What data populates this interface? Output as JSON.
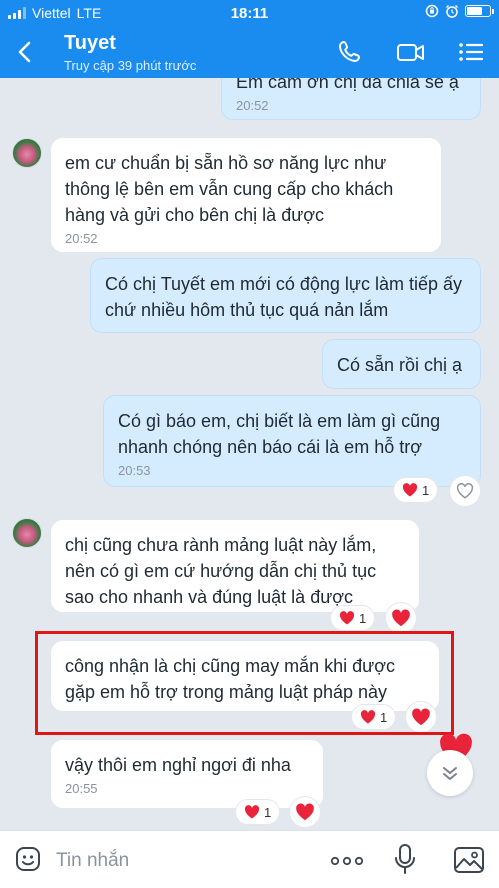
{
  "status_bar": {
    "carrier": "Viettel",
    "network": "LTE",
    "time": "18:11"
  },
  "header": {
    "contact_name": "Tuyet",
    "last_seen": "Truy cập 39 phút trước",
    "icons": [
      "back-icon",
      "phone-icon",
      "video-call-icon",
      "menu-icon"
    ]
  },
  "messages": [
    {
      "dir": "out",
      "text": "Em cảm ơn chị đã chia sẻ ạ",
      "time": "20:52"
    },
    {
      "dir": "in",
      "text": "em cư chuẩn bị sẵn hồ sơ năng lực như thông lệ bên em vẫn cung cấp cho khách hàng và gửi cho bên chị là được",
      "time": "20:52"
    },
    {
      "dir": "out",
      "text": "Có chị Tuyết em mới có động lực làm tiếp ấy chứ nhiều hôm thủ tục quá nản lắm",
      "time": ""
    },
    {
      "dir": "out",
      "text": "Có sẵn rồi chị ạ",
      "time": ""
    },
    {
      "dir": "out",
      "text": "Có gì báo em, chị biết là em làm gì cũng nhanh chóng nên báo cái là em hỗ trợ",
      "time": "20:53",
      "reactions": "1"
    },
    {
      "dir": "in",
      "text": "chị cũng chưa rành mảng luật này lắm, nên có gì em cứ hướng dẫn chị thủ tục sao cho nhanh và đúng luật là được",
      "time": "",
      "reactions": "1"
    },
    {
      "dir": "in",
      "text": "công nhận là chị cũng may mắn khi được gặp em hỗ trợ trong mảng luật pháp này",
      "time": "",
      "reactions": "1"
    },
    {
      "dir": "in",
      "text": "vậy thôi em nghỉ ngơi đi nha",
      "time": "20:55",
      "reactions": "1"
    }
  ],
  "input": {
    "placeholder": "Tin nhắn",
    "icons": [
      "sticker-icon",
      "more-icon",
      "microphone-icon",
      "image-icon"
    ]
  },
  "colors": {
    "header_bg": "#1a8cf0",
    "chat_bg": "#e3e8ef",
    "outgoing_bubble": "#d5ecff",
    "incoming_bubble": "#ffffff",
    "highlight_border": "#e01616",
    "heart": "#e8233a"
  }
}
